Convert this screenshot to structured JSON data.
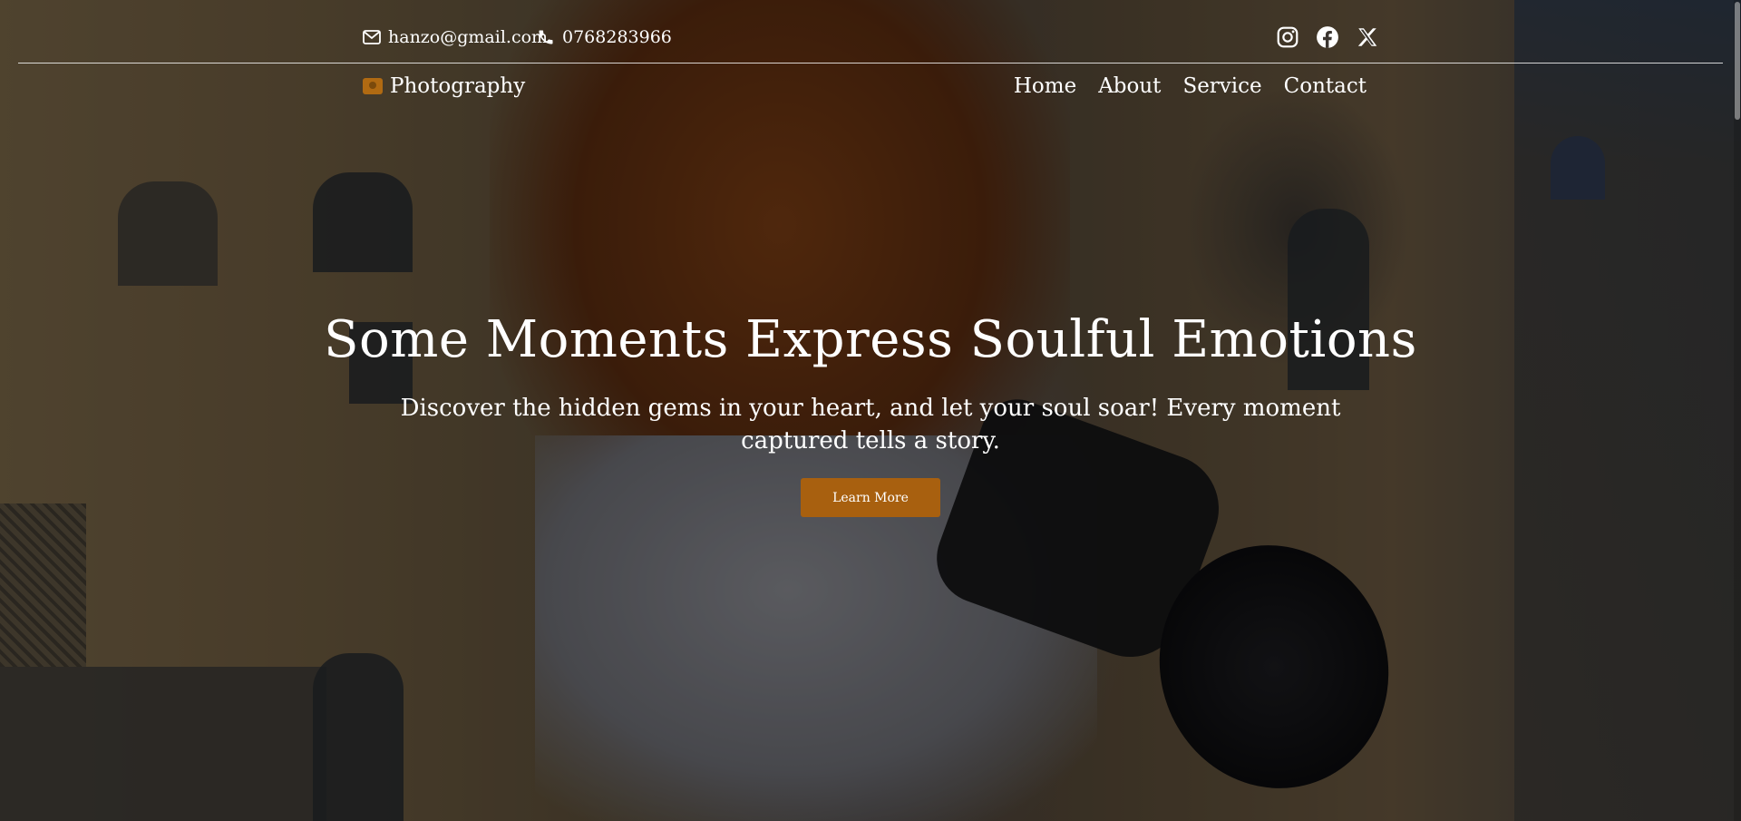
{
  "topbar": {
    "email": "hanzo@gmail.com",
    "phone": "0768283966",
    "social": [
      "instagram-icon",
      "facebook-icon",
      "x-icon"
    ]
  },
  "nav": {
    "brand": "Photography",
    "links": [
      "Home",
      "About",
      "Service",
      "Contact"
    ]
  },
  "hero": {
    "title": "Some Moments Express Soulful Emotions",
    "subtitle": "Discover the hidden gems in your heart, and let your soul soar! Every moment captured tells a story.",
    "cta_label": "Learn More"
  },
  "colors": {
    "accent": "#a8600f",
    "text": "#ffffff"
  }
}
